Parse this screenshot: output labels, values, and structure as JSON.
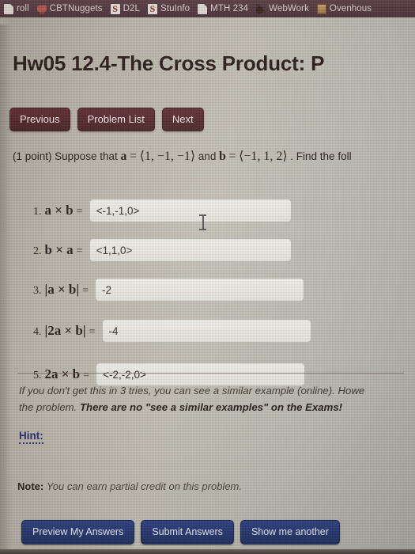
{
  "browser": {
    "bookmarks": [
      {
        "label": "roll",
        "icon": "generic-icon",
        "icon_class": "ico-page"
      },
      {
        "label": "CBTNuggets",
        "icon": "cbtnuggets-icon",
        "icon_class": "ico-cbt"
      },
      {
        "label": "D2L",
        "icon": "s-logo-icon",
        "icon_class": "ico-s",
        "glyph": "S"
      },
      {
        "label": "StuInfo",
        "icon": "s-logo-icon",
        "icon_class": "ico-s",
        "glyph": "S"
      },
      {
        "label": "MTH 234",
        "icon": "page-icon",
        "icon_class": "ico-page"
      },
      {
        "label": "WebWork",
        "icon": "webwork-icon",
        "icon_class": "ico-ww"
      },
      {
        "label": "Ovenhous",
        "icon": "ovenhouse-icon",
        "icon_class": "ico-oven"
      }
    ]
  },
  "header": {
    "title": "Hw05 12.4-The Cross Product: P"
  },
  "nav": {
    "previous_label": "Previous",
    "problem_list_label": "Problem List",
    "next_label": "Next"
  },
  "problem": {
    "points": "(1 point)",
    "lead": "Suppose that",
    "vector_a_name": "a",
    "equals": "=",
    "vector_a_value": "⟨1, −1, −1⟩",
    "and": "and",
    "vector_b_name": "b",
    "vector_b_value": "⟨−1, 1, 2⟩",
    "tail": ". Find the foll"
  },
  "answers": [
    {
      "number": "1.",
      "expression_html": "a × b",
      "equals": "=",
      "value": "<-1,-1,0>",
      "placeholder": ""
    },
    {
      "number": "2.",
      "expression_html": "b × a",
      "equals": "=",
      "value": "<1,1,0>",
      "placeholder": ""
    },
    {
      "number": "3.",
      "expression_html": "|a × b|",
      "equals": "=",
      "value": "-2",
      "placeholder": ""
    },
    {
      "number": "4.",
      "expression_html": "|2a × b|",
      "equals": "=",
      "value": "-4",
      "placeholder": ""
    },
    {
      "number": "5.",
      "expression_html": "2a × b",
      "equals": "=",
      "value": "<-2,-2,0>",
      "placeholder": ""
    }
  ],
  "similar_example_note": {
    "line1": "If you don't get this in 3 tries, you can see a similar example (online). Howe",
    "line2_plain": "the problem.",
    "line2_strong": "There are no \"see a similar examples\" on the Exams!"
  },
  "hint": {
    "label": "Hint:"
  },
  "note": {
    "label": "Note:",
    "text": "You can earn partial credit on this problem."
  },
  "footer": {
    "preview_label": "Preview My Answers",
    "submit_label": "Submit Answers",
    "show_another_label": "Show me another"
  },
  "colors": {
    "nav_button_bg": "#51252a",
    "submit_button_bg": "#243670",
    "hint_link": "#262a6e",
    "bookmarks_bar_bg": "#53383f",
    "page_bg": "#b7b1a6"
  }
}
